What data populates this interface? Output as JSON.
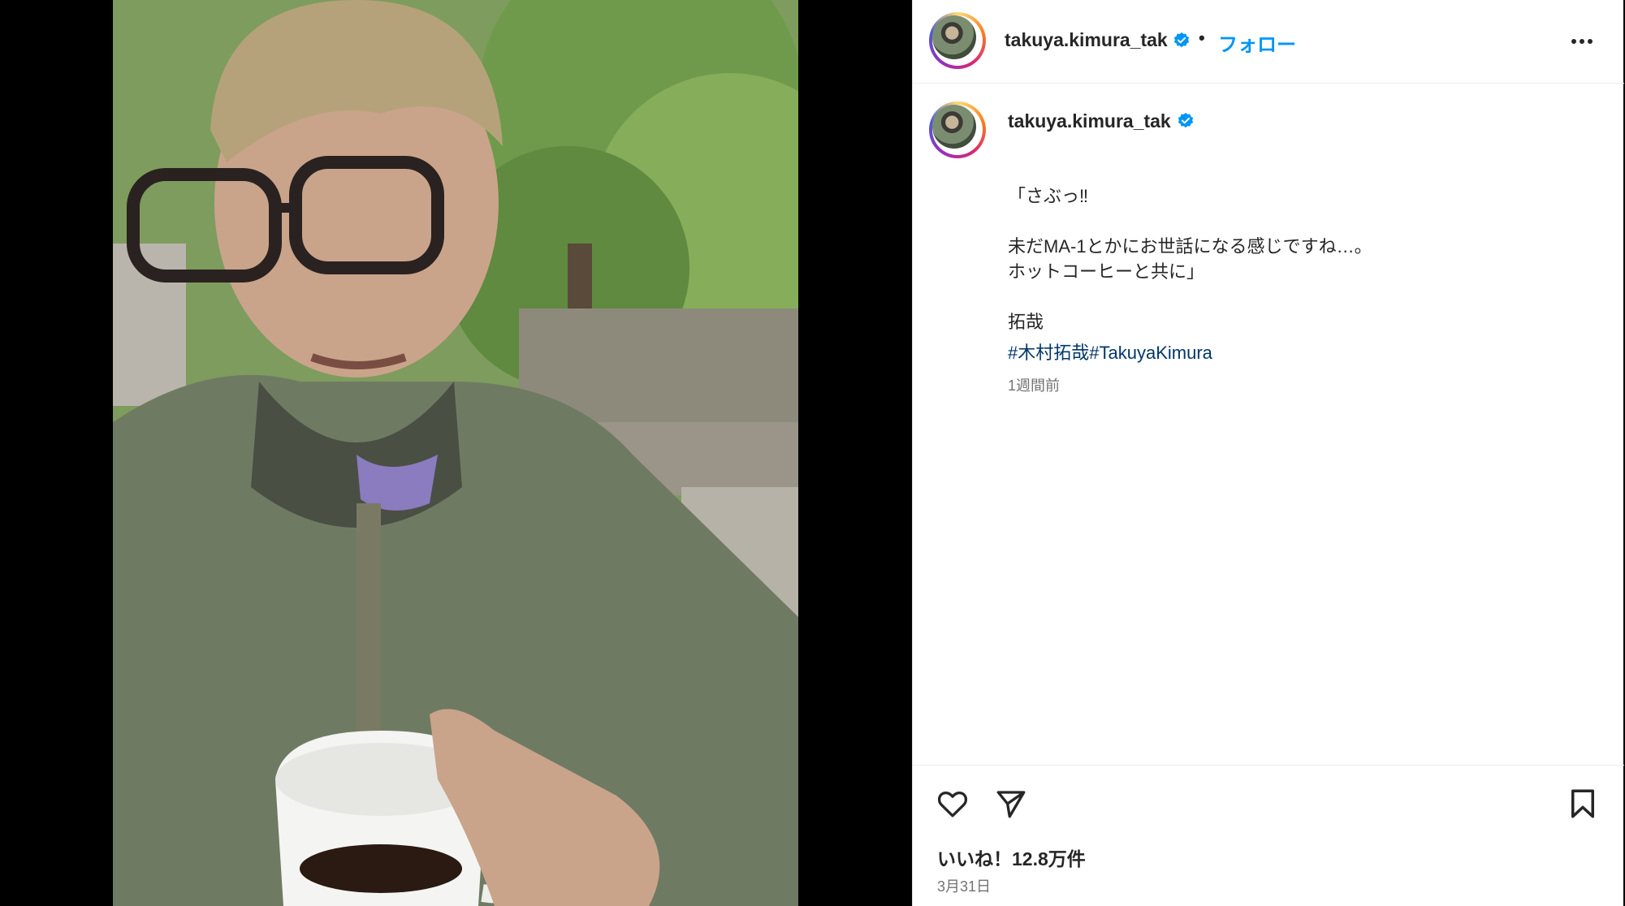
{
  "post": {
    "image_alt_subject": "selfie-photo",
    "author": {
      "username": "takuya.kimura_tak",
      "verified": true
    },
    "header": {
      "separator": "•",
      "follow_label": "フォロー",
      "more_icon": "more-horizontal-icon"
    },
    "caption": {
      "lines": [
        "「さぶっ‼",
        "",
        "未だMA-1とかにお世話になる感じですね…。",
        "ホットコーヒーと共に」",
        "",
        "拓哉"
      ],
      "hashtags": [
        "#木村拓哉",
        "#TakuyaKimura"
      ],
      "time_ago": "1週間前"
    },
    "actions": {
      "like_icon": "heart-icon",
      "share_icon": "send-icon",
      "save_icon": "bookmark-icon",
      "likes_text": "いいね！12.8万件",
      "date": "3月31日"
    },
    "colors": {
      "accent_link": "#0095f6",
      "hashtag": "#00376b",
      "verified_badge": "#0095f6",
      "muted_text": "#737373"
    }
  }
}
